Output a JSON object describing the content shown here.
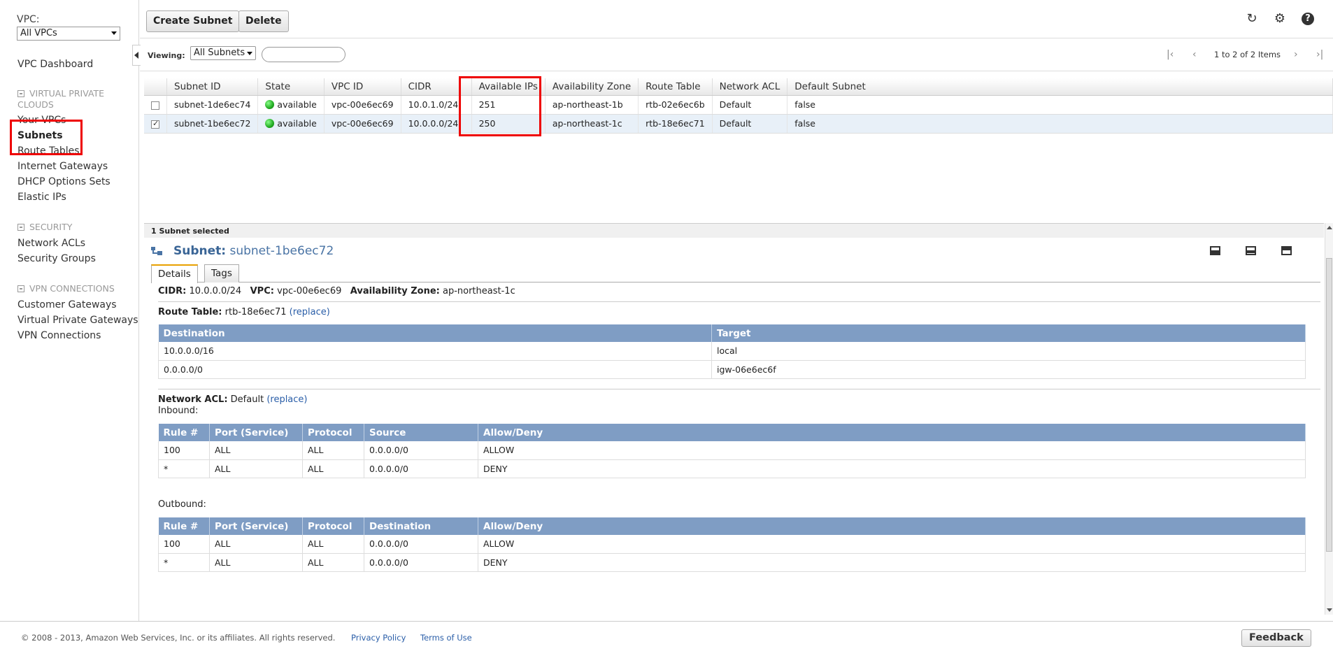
{
  "sidebar": {
    "vpc_label": "VPC:",
    "vpc_select": "All VPCs",
    "dashboard": "VPC Dashboard",
    "sections": [
      {
        "title": "VIRTUAL PRIVATE CLOUDS",
        "items": [
          "Your VPCs",
          "Subnets",
          "Route Tables",
          "Internet Gateways",
          "DHCP Options Sets",
          "Elastic IPs"
        ]
      },
      {
        "title": "SECURITY",
        "items": [
          "Network ACLs",
          "Security Groups"
        ]
      },
      {
        "title": "VPN CONNECTIONS",
        "items": [
          "Customer Gateways",
          "Virtual Private Gateways",
          "VPN Connections"
        ]
      }
    ],
    "active_item": "Subnets"
  },
  "toolbar": {
    "create_label": "Create Subnet",
    "delete_label": "Delete"
  },
  "viewbar": {
    "viewing_label": "Viewing:",
    "viewing_select": "All Subnets",
    "search_value": "",
    "pager_text": "1 to 2 of 2 Items"
  },
  "grid": {
    "columns": [
      "Subnet ID",
      "State",
      "VPC ID",
      "CIDR",
      "Available IPs",
      "Availability Zone",
      "Route Table",
      "Network ACL",
      "Default Subnet"
    ],
    "rows": [
      {
        "checked": false,
        "subnet_id": "subnet-1de6ec74",
        "state": "available",
        "vpc_id": "vpc-00e6ec69",
        "cidr": "10.0.1.0/24",
        "available_ips": "251",
        "az": "ap-northeast-1b",
        "route_table": "rtb-02e6ec6b",
        "acl": "Default",
        "default": "false"
      },
      {
        "checked": true,
        "subnet_id": "subnet-1be6ec72",
        "state": "available",
        "vpc_id": "vpc-00e6ec69",
        "cidr": "10.0.0.0/24",
        "available_ips": "250",
        "az": "ap-northeast-1c",
        "route_table": "rtb-18e6ec71",
        "acl": "Default",
        "default": "false"
      }
    ]
  },
  "detail": {
    "selected_text": "1 Subnet selected",
    "title_label": "Subnet:",
    "title_value": "subnet-1be6ec72",
    "tabs": [
      "Details",
      "Tags"
    ],
    "cidr_label": "CIDR:",
    "cidr": "10.0.0.0/24",
    "vpc_label": "VPC:",
    "vpc": "vpc-00e6ec69",
    "az_label": "Availability Zone:",
    "az": "ap-northeast-1c",
    "rt_label": "Route Table:",
    "rt": "rtb-18e6ec71",
    "replace": "(replace)",
    "routes": {
      "columns": [
        "Destination",
        "Target"
      ],
      "rows": [
        [
          "10.0.0.0/16",
          "local"
        ],
        [
          "0.0.0.0/0",
          "igw-06e6ec6f"
        ]
      ]
    },
    "acl_label": "Network ACL:",
    "acl": "Default",
    "inbound_label": "Inbound:",
    "inbound": {
      "columns": [
        "Rule #",
        "Port (Service)",
        "Protocol",
        "Source",
        "Allow/Deny"
      ],
      "rows": [
        [
          "100",
          "ALL",
          "ALL",
          "0.0.0.0/0",
          "ALLOW"
        ],
        [
          "*",
          "ALL",
          "ALL",
          "0.0.0.0/0",
          "DENY"
        ]
      ]
    },
    "outbound_label": "Outbound:",
    "outbound": {
      "columns": [
        "Rule #",
        "Port (Service)",
        "Protocol",
        "Destination",
        "Allow/Deny"
      ],
      "rows": [
        [
          "100",
          "ALL",
          "ALL",
          "0.0.0.0/0",
          "ALLOW"
        ],
        [
          "*",
          "ALL",
          "ALL",
          "0.0.0.0/0",
          "DENY"
        ]
      ]
    }
  },
  "footer": {
    "copyright": "© 2008 - 2013, Amazon Web Services, Inc. or its affiliates. All rights reserved.",
    "privacy": "Privacy Policy",
    "terms": "Terms of Use",
    "feedback": "Feedback"
  },
  "colors": {
    "highlight": "#ee0000",
    "table_header": "#7f9dc4",
    "link": "#2a5ea8"
  },
  "icons": [
    "refresh-icon",
    "gear-icon",
    "help-icon",
    "first-page-icon",
    "prev-page-icon",
    "next-page-icon",
    "last-page-icon",
    "subnet-icon"
  ]
}
